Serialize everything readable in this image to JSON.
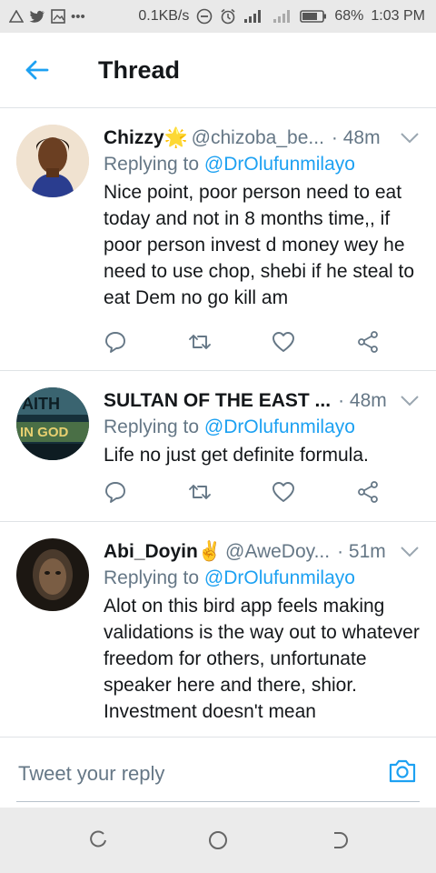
{
  "status_bar": {
    "speed": "0.1KB/s",
    "battery": "68%",
    "time": "1:03 PM"
  },
  "header": {
    "title": "Thread"
  },
  "tweets": [
    {
      "name": "Chizzy🌟",
      "handle": "@chizoba_be...",
      "time": "· 48m",
      "replying_label": "Replying to",
      "replying_to": "@DrOlufunmilayo",
      "text": "Nice point, poor person need to eat today and not in 8 months time,, if poor person invest d money wey he need to use chop, shebi if he steal to eat Dem no go kill am"
    },
    {
      "name": "SULTAN OF THE EAST ...",
      "handle": "",
      "time": "· 48m",
      "replying_label": "Replying to",
      "replying_to": "@DrOlufunmilayo",
      "text": "Life no just get definite formula.",
      "avatar_text": "IN GOD"
    },
    {
      "name": "Abi_Doyin✌",
      "handle": "@AweDoy...",
      "time": "· 51m",
      "replying_label": "Replying to",
      "replying_to": "@DrOlufunmilayo",
      "text": "Alot on this bird app feels making validations is the way out to whatever freedom for others, unfortunate speaker here and there, shior. Investment doesn't mean"
    }
  ],
  "composer": {
    "placeholder": "Tweet your reply"
  },
  "colors": {
    "accent": "#1da1f2",
    "secondary_text": "#657786",
    "divider": "#dfe3e6"
  }
}
